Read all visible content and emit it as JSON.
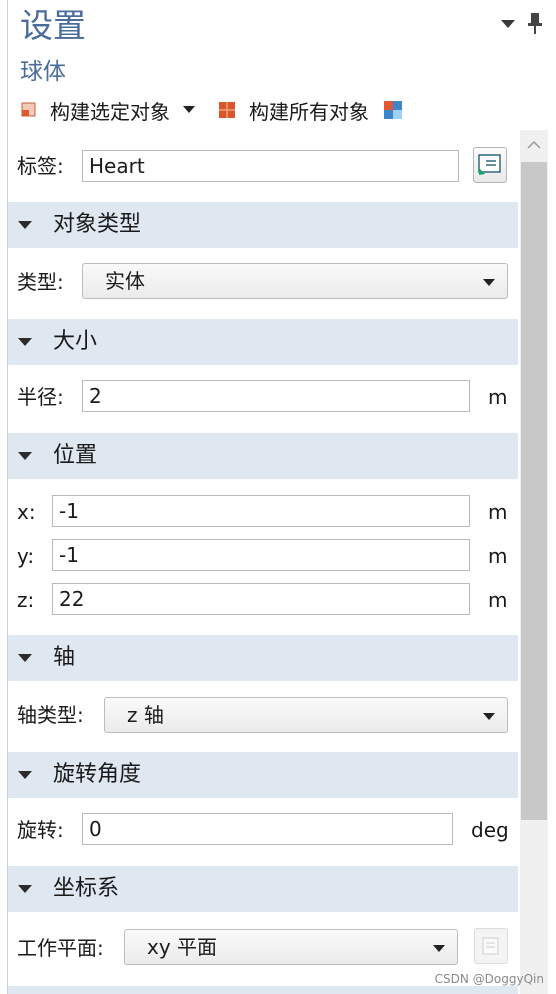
{
  "header": {
    "title": "设置",
    "subtitle": "球体",
    "menu_icon": "triangle-down-icon",
    "pin_icon": "pin-icon"
  },
  "toolbar": {
    "build_selected_label": "构建选定对象",
    "build_all_label": "构建所有对象"
  },
  "label_row": {
    "label": "标签:",
    "value": "Heart"
  },
  "sections": {
    "object_type": {
      "title": "对象类型",
      "type_label": "类型:",
      "type_value": "实体"
    },
    "size": {
      "title": "大小",
      "radius_label": "半径:",
      "radius_value": "2",
      "radius_unit": "m"
    },
    "position": {
      "title": "位置",
      "x_label": "x:",
      "x_value": "-1",
      "x_unit": "m",
      "y_label": "y:",
      "y_value": "-1",
      "y_unit": "m",
      "z_label": "z:",
      "z_value": "22",
      "z_unit": "m"
    },
    "axis": {
      "title": "轴",
      "axis_type_label": "轴类型:",
      "axis_type_value": "z 轴"
    },
    "rotation": {
      "title": "旋转角度",
      "rotation_label": "旋转:",
      "rotation_value": "0",
      "rotation_unit": "deg"
    },
    "coordinate_system": {
      "title": "坐标系",
      "work_plane_label": "工作平面:",
      "work_plane_value": "xy 平面"
    }
  },
  "watermark": "CSDN @DoggyQin"
}
